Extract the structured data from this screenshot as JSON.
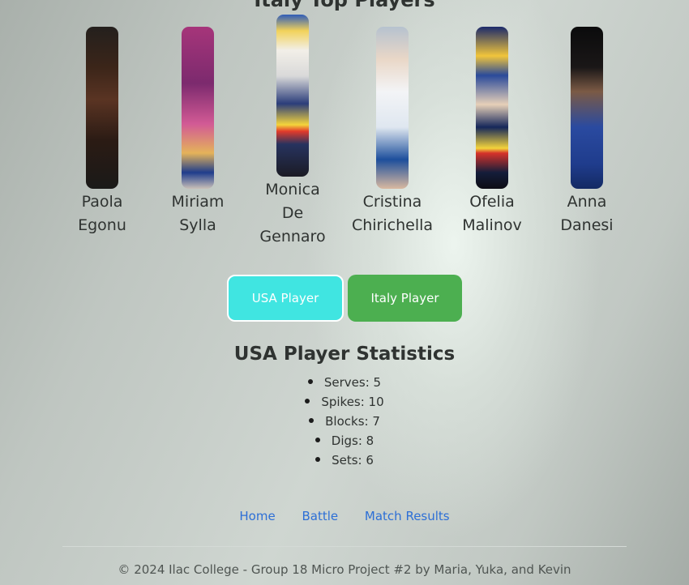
{
  "header": {
    "title": "Italy Top Players"
  },
  "players": [
    {
      "first": "Paola",
      "last": "Egonu"
    },
    {
      "first": "Miriam",
      "last": "Sylla"
    },
    {
      "first": "Monica",
      "middle": "De",
      "last": "Gennaro"
    },
    {
      "first": "Cristina",
      "last": "Chirichella"
    },
    {
      "first": "Ofelia",
      "last": "Malinov"
    },
    {
      "first": "Anna",
      "last": "Danesi"
    }
  ],
  "buttons": {
    "usa": "USA Player",
    "italy": "Italy Player"
  },
  "colors": {
    "usa_button": "#40e5e1",
    "italy_button": "#4caf50",
    "link": "#2d6fd6"
  },
  "stats": {
    "title": "USA Player Statistics",
    "items": [
      "Serves: 5",
      "Spikes: 10",
      "Blocks: 7",
      "Digs: 8",
      "Sets: 6"
    ]
  },
  "nav": {
    "home": "Home",
    "battle": "Battle",
    "results": "Match Results"
  },
  "footer": {
    "text": "© 2024 Ilac College - Group 18 Micro Project #2 by Maria, Yuka, and Kevin"
  }
}
